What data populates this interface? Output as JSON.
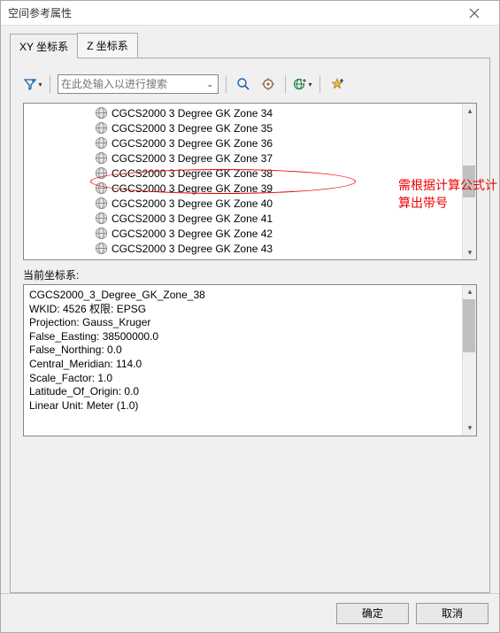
{
  "window": {
    "title": "空间参考属性"
  },
  "tabs": {
    "xy": "XY 坐标系",
    "z": "Z 坐标系"
  },
  "search": {
    "placeholder": "在此处输入以进行搜索"
  },
  "list": {
    "items": [
      "CGCS2000 3 Degree GK Zone 34",
      "CGCS2000 3 Degree GK Zone 35",
      "CGCS2000 3 Degree GK Zone 36",
      "CGCS2000 3 Degree GK Zone 37",
      "CGCS2000 3 Degree GK Zone 38",
      "CGCS2000 3 Degree GK Zone 39",
      "CGCS2000 3 Degree GK Zone 40",
      "CGCS2000 3 Degree GK Zone 41",
      "CGCS2000 3 Degree GK Zone 42",
      "CGCS2000 3 Degree GK Zone 43"
    ]
  },
  "current_label": "当前坐标系:",
  "details": {
    "l1": "CGCS2000_3_Degree_GK_Zone_38",
    "l2": "WKID: 4526 权限: EPSG",
    "l3": "",
    "l4": "Projection: Gauss_Kruger",
    "l5": "False_Easting: 38500000.0",
    "l6": "False_Northing: 0.0",
    "l7": "Central_Meridian: 114.0",
    "l8": "Scale_Factor: 1.0",
    "l9": "Latitude_Of_Origin: 0.0",
    "l10": "Linear Unit: Meter (1.0)"
  },
  "annotation": {
    "line1": "需根据计算公式计",
    "line2": "算出带号"
  },
  "buttons": {
    "ok": "确定",
    "cancel": "取消"
  }
}
